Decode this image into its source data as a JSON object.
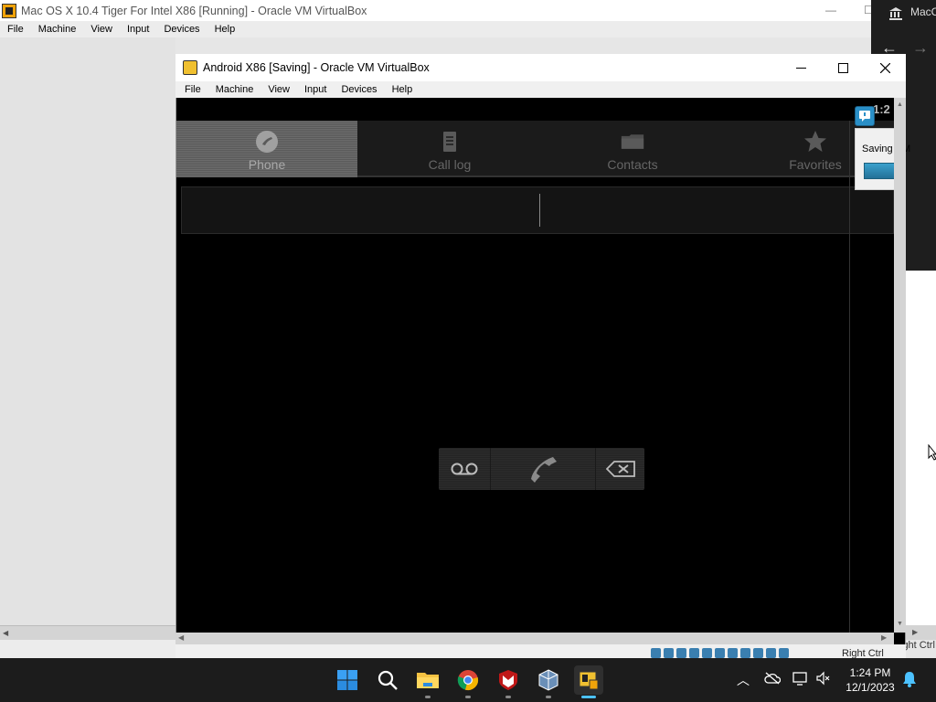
{
  "background_window": {
    "title": "Mac OS X 10.4 Tiger For Intel X86 [Running] - Oracle VM VirtualBox",
    "menu": [
      "File",
      "Machine",
      "View",
      "Input",
      "Devices",
      "Help"
    ],
    "status_right": "ight Ctrl"
  },
  "right_window": {
    "tab_title": "MacC"
  },
  "main_window": {
    "title": "Android X86  [Saving] - Oracle VM VirtualBox",
    "menu": [
      "File",
      "Machine",
      "View",
      "Input",
      "Devices",
      "Help"
    ],
    "host_key": "Right Ctrl"
  },
  "android": {
    "time": "1:2",
    "tabs": [
      {
        "label": "Phone",
        "active": true,
        "icon": "phone-icon"
      },
      {
        "label": "Call log",
        "active": false,
        "icon": "call-log-icon"
      },
      {
        "label": "Contacts",
        "active": false,
        "icon": "contacts-icon"
      },
      {
        "label": "Favorites",
        "active": false,
        "icon": "star-icon"
      }
    ],
    "dial_input_value": "",
    "actions": [
      "voicemail-icon",
      "call-icon",
      "backspace-icon"
    ]
  },
  "saving_popup": {
    "text": "Saving VM",
    "progress_percent": 100
  },
  "taskbar": {
    "apps": [
      "windows-start-icon",
      "search-icon",
      "file-explorer-icon",
      "chrome-icon",
      "mcafee-icon",
      "virtualbox-icon",
      "virtualbox-vm-icon"
    ],
    "time": "1:24 PM",
    "date": "12/1/2023"
  }
}
